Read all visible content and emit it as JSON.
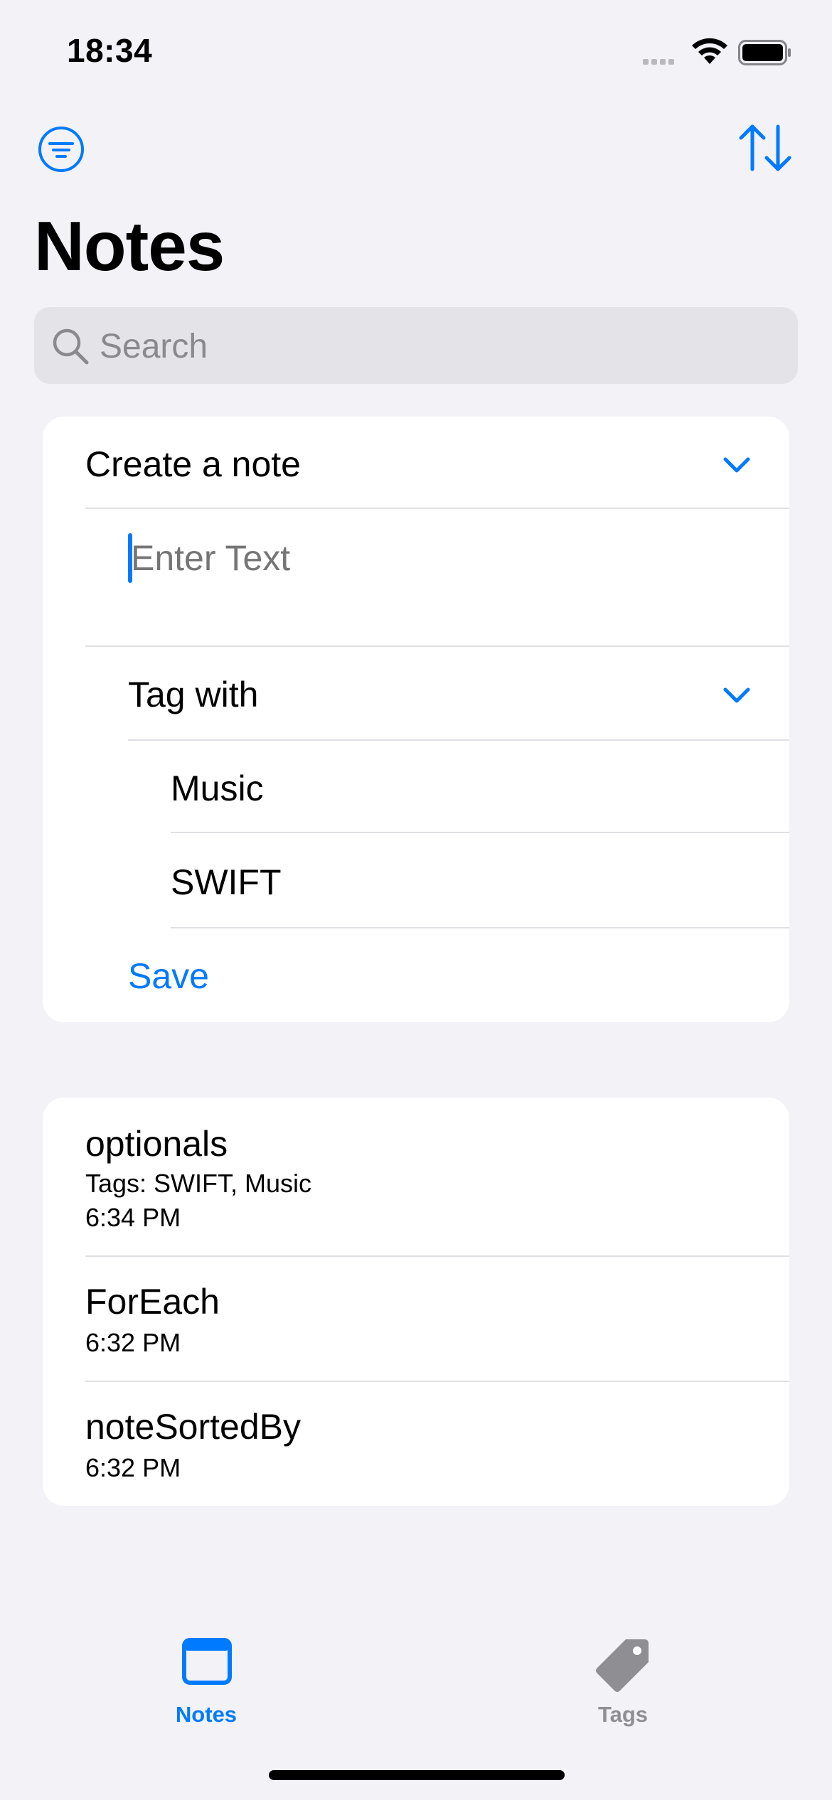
{
  "status_bar": {
    "time": "18:34"
  },
  "header": {
    "title": "Notes",
    "search_placeholder": "Search"
  },
  "create_note": {
    "section_label": "Create a note",
    "text_placeholder": "Enter Text",
    "tag_section_label": "Tag with",
    "tags": [
      "Music",
      "SWIFT"
    ],
    "save_label": "Save"
  },
  "notes": [
    {
      "title": "optionals",
      "tags": "Tags: SWIFT, Music",
      "time": "6:34 PM"
    },
    {
      "title": "ForEach",
      "time": "6:32 PM"
    },
    {
      "title": "noteSortedBy",
      "time": "6:32 PM"
    }
  ],
  "tab_bar": {
    "items": [
      {
        "label": "Notes",
        "icon": "window-icon",
        "selected": true
      },
      {
        "label": "Tags",
        "icon": "tag-icon",
        "selected": false
      }
    ]
  },
  "colors": {
    "accent": "#007AFF",
    "background": "#F2F2F7",
    "inactive": "#8E8E93"
  }
}
